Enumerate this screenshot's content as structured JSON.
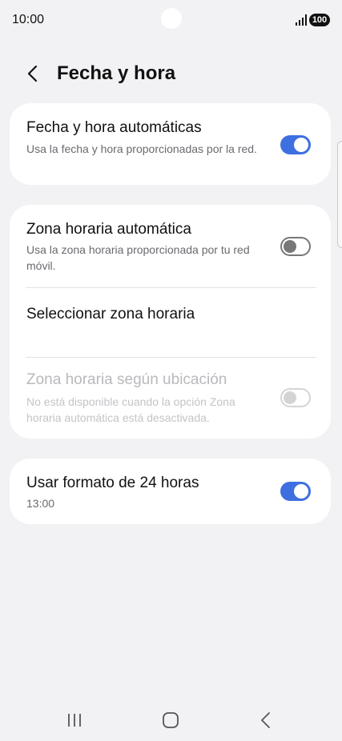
{
  "status_bar": {
    "time": "10:00",
    "battery": "100",
    "signal_icon": "signal-bars-icon"
  },
  "header": {
    "back_icon": "chevron-left-icon",
    "title": "Fecha y hora"
  },
  "settings": {
    "auto_datetime": {
      "title": "Fecha y hora automáticas",
      "subtitle": "Usa la fecha y hora proporcionadas por la red.",
      "enabled": true
    },
    "auto_timezone": {
      "title": "Zona horaria automática",
      "subtitle": "Usa la zona horaria proporcionada por tu red móvil.",
      "enabled": false
    },
    "select_timezone": {
      "title": "Seleccionar zona horaria"
    },
    "location_timezone": {
      "title": "Zona horaria según ubicación",
      "subtitle": "No está disponible cuando la opción Zona horaria automática está desactivada.",
      "enabled": false,
      "available": false
    },
    "format_24h": {
      "title": "Usar formato de 24 horas",
      "subtitle": "13:00",
      "enabled": true
    }
  },
  "nav_bar": {
    "recents_icon": "recents-icon",
    "home_icon": "home-icon",
    "back_icon": "back-icon"
  },
  "colors": {
    "accent": "#3e6fe0",
    "background": "#f2f2f4",
    "card": "#ffffff"
  }
}
